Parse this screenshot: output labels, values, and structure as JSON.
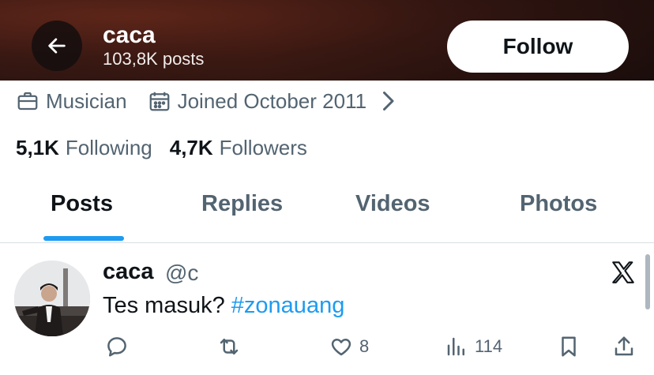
{
  "header": {
    "name": "caca",
    "posts_count": "103,8K posts",
    "follow_label": "Follow"
  },
  "profile": {
    "category": "Musician",
    "joined": "Joined October 2011"
  },
  "stats": {
    "following_count": "5,1K",
    "following_label": "Following",
    "followers_count": "4,7K",
    "followers_label": "Followers"
  },
  "tabs": [
    {
      "label": "Posts",
      "active": true
    },
    {
      "label": "Replies",
      "active": false
    },
    {
      "label": "Videos",
      "active": false
    },
    {
      "label": "Photos",
      "active": false
    }
  ],
  "post": {
    "name": "caca",
    "handle": "@c",
    "text": "Tes masuk? ",
    "hashtag": "#zonauang",
    "likes": "8",
    "views": "114"
  },
  "icons": {
    "back": "arrow-left-icon",
    "category": "briefcase-icon",
    "joined": "calendar-icon",
    "more": "chevron-right-icon",
    "source": "x-logo-icon",
    "reply": "reply-icon",
    "repost": "repost-icon",
    "like": "heart-icon",
    "views": "views-icon",
    "bookmark": "bookmark-icon",
    "share": "share-icon"
  },
  "colors": {
    "accent": "#1d9bf0",
    "text_primary": "#0f1419",
    "text_secondary": "#536471"
  }
}
